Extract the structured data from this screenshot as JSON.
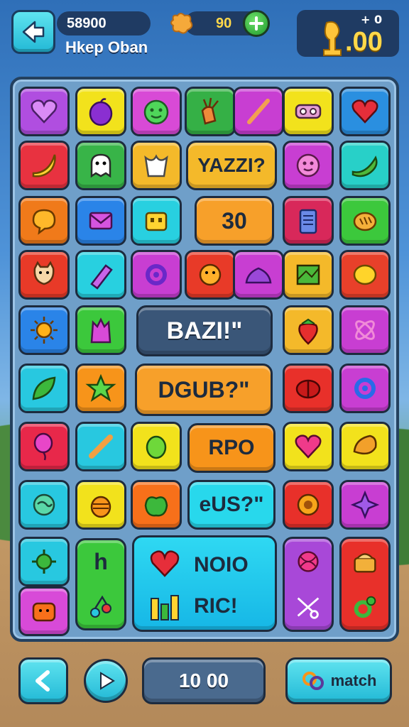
{
  "hud": {
    "score": "58900",
    "player_name": "Hkep Oban",
    "coins": "90",
    "panel_top": "+ 0",
    "panel_value": ".00"
  },
  "board": {
    "banner_1": "YAZZI?",
    "banner_2": "30",
    "banner_3": "BAZI!\"",
    "banner_4": "DGUB?\"",
    "banner_5": "RPO",
    "banner_6": "eUS?\"",
    "tile_letter": "h",
    "panel_line_1": "NOIO",
    "panel_line_2": "RIC!"
  },
  "bottom": {
    "counter": "10 00",
    "match_label": "match"
  },
  "colors": {
    "board_bg": "#6f9fc9",
    "outline": "#1d2b3e",
    "accent_cyan": "#23b9d6",
    "accent_yellow": "#ffd84a"
  },
  "icons": [
    "back-arrow-icon",
    "coin-icon",
    "plus-icon",
    "trophy-icon",
    "heart-icon",
    "banana-icon",
    "star-icon",
    "leaf-icon",
    "strawberry-icon",
    "gear-icon",
    "apple-icon",
    "pear-icon",
    "swirl-icon"
  ]
}
